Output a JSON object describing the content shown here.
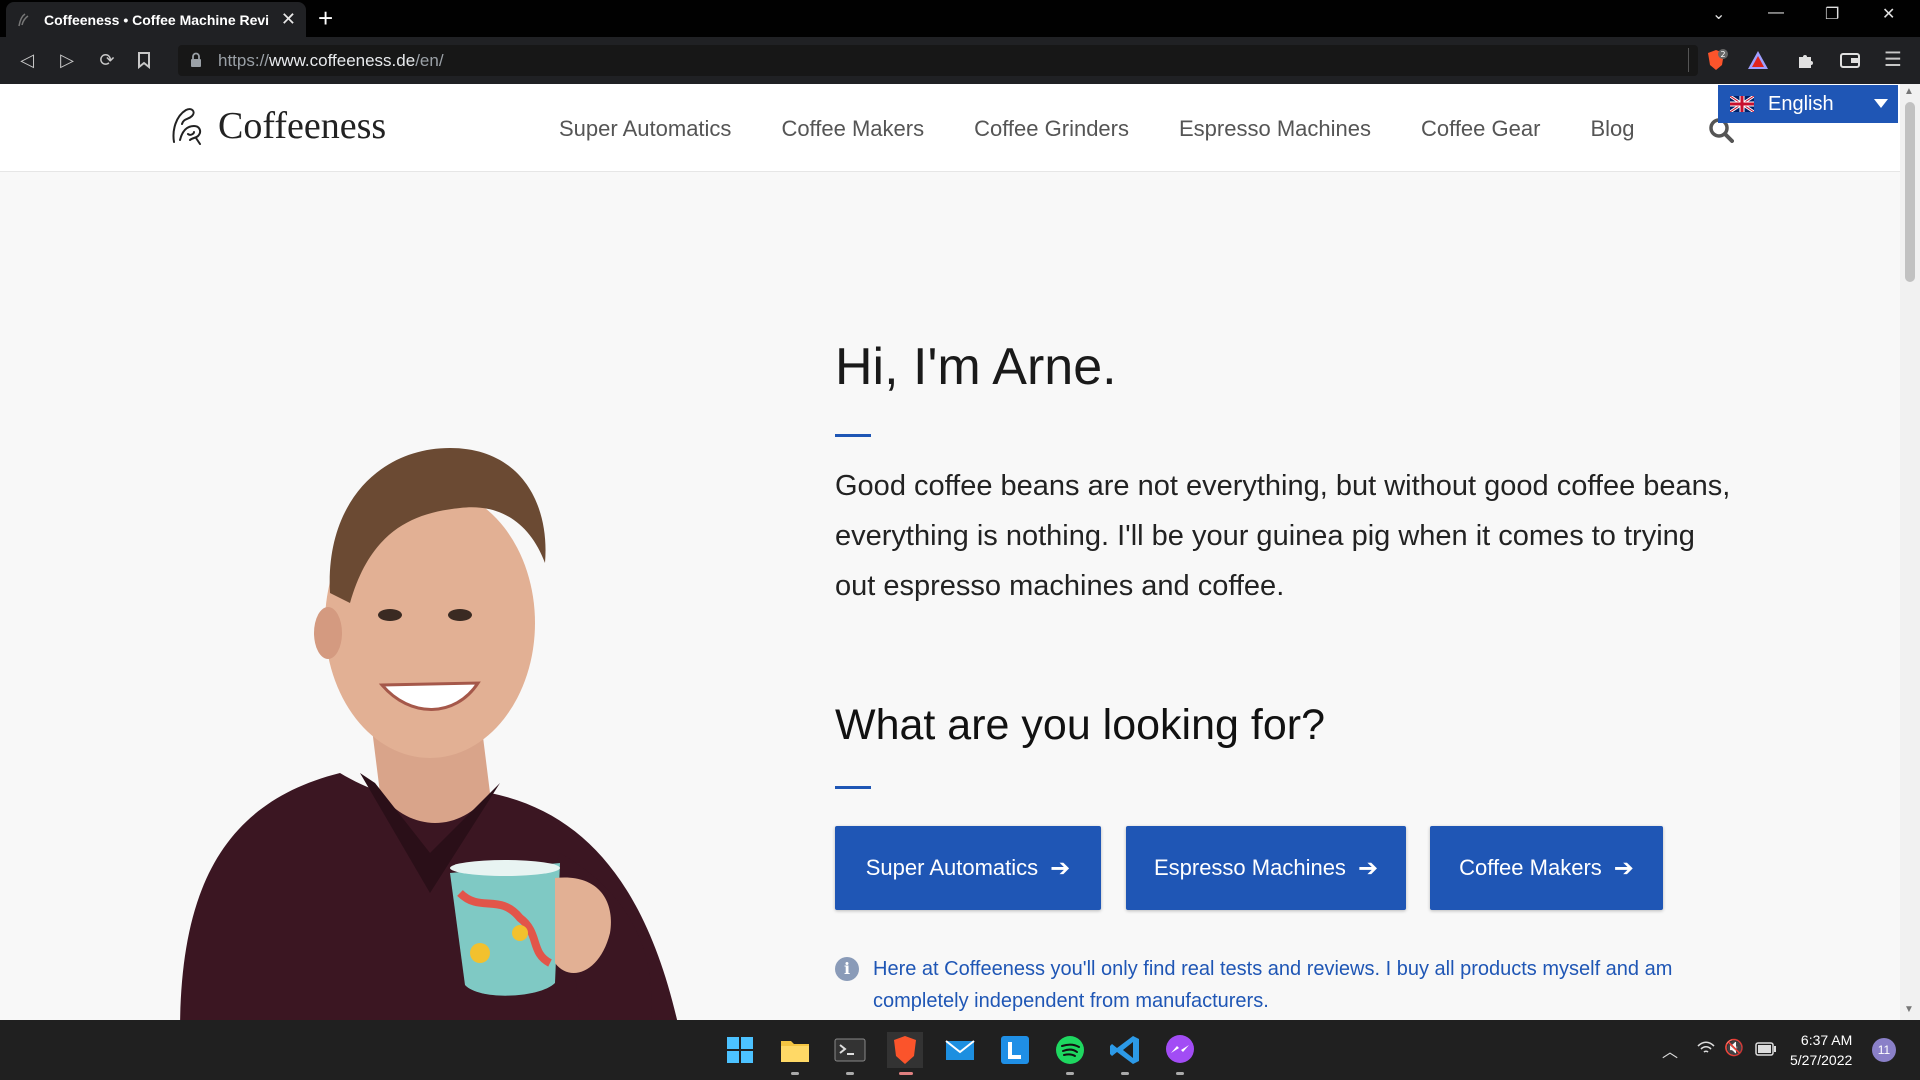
{
  "browser": {
    "tab_title": "Coffeeness • Coffee Machine Revi",
    "url_scheme": "https://",
    "url_host": "www.coffeeness.de",
    "url_path": "/en/",
    "shield_count": "2"
  },
  "site": {
    "logo_text": "Coffeeness",
    "nav": [
      "Super Automatics",
      "Coffee Makers",
      "Coffee Grinders",
      "Espresso Machines",
      "Coffee Gear",
      "Blog"
    ],
    "language": "English"
  },
  "hero": {
    "title": "Hi, I'm Arne.",
    "text": "Good coffee beans are not everything, but without good coffee beans, everything is nothing. I'll be your guinea pig when it comes to trying out espresso machines and coffee.",
    "looking_for": "What are you looking for?",
    "buttons": [
      "Super Automatics",
      "Espresso Machines",
      "Coffee Makers"
    ],
    "info": "Here at Coffeeness you'll only find real tests and reviews. I buy all products myself and am completely independent from manufacturers."
  },
  "taskbar": {
    "time": "6:37 AM",
    "date": "5/27/2022",
    "notifications": "11"
  },
  "colors": {
    "accent": "#1f56b5",
    "browser_dark": "#202124",
    "page_bg": "#f8f8f8"
  }
}
